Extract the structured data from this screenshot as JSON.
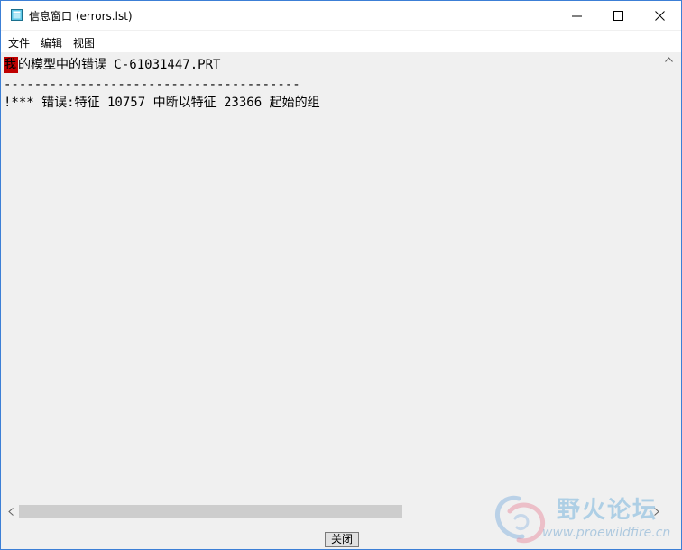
{
  "window": {
    "title": "信息窗口 (errors.lst)"
  },
  "menu": {
    "items": [
      "文件",
      "编辑",
      "视图"
    ]
  },
  "content": {
    "caret_char": "我",
    "line1": "的模型中的错误 C-61031447.PRT",
    "line2": "---------------------------------------",
    "line3": "!*** 错误:特征 10757 中断以特征 23366 起始的组"
  },
  "footer": {
    "close_label": "关闭"
  },
  "watermark": {
    "title": "野火论坛",
    "url": "www.proewildfire.cn"
  },
  "colors": {
    "border": "#3c7fd6",
    "background": "#f0f0f0",
    "caret": "#c00000",
    "scroll_thumb": "#cdcdcd"
  },
  "scroll": {
    "horizontal_thumb_fraction": 0.62
  }
}
